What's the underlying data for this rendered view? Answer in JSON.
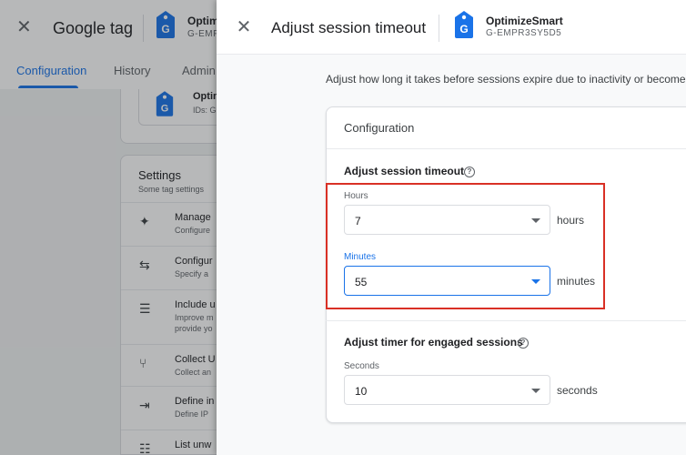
{
  "background": {
    "close_glyph": "✕",
    "title": "Google tag",
    "tag_name": "Optim",
    "tag_id": "G-EMPR",
    "tabs": [
      "Configuration",
      "History",
      "Admin"
    ],
    "card": {
      "name": "Optim",
      "ids": "IDs: G"
    },
    "settings": {
      "title": "Settings",
      "subtitle": "Some tag settings",
      "rows": [
        {
          "icon": "sparkle-icon",
          "glyph": "✦",
          "title": "Manage",
          "sub": "Configure"
        },
        {
          "icon": "merge-arrows-icon",
          "glyph": "⇆",
          "title": "Configur",
          "sub": "Specify a"
        },
        {
          "icon": "consent-list-icon",
          "glyph": "☰",
          "title": "Include u",
          "sub": "Improve m"
        },
        {
          "icon": "fork-icon",
          "glyph": "⑂",
          "title": "Collect U",
          "sub": "Collect an"
        },
        {
          "icon": "login-arrow-icon",
          "glyph": "⇥",
          "title": "Define in",
          "sub": "Define IP"
        },
        {
          "icon": "list-x-icon",
          "glyph": "☷",
          "title": "List unw",
          "sub": ""
        }
      ],
      "extra_line": "provide yo"
    }
  },
  "panel": {
    "close_glyph": "✕",
    "title": "Adjust session timeout",
    "tag_name": "OptimizeSmart",
    "tag_id": "G-EMPR3SY5D5",
    "description": "Adjust how long it takes before sessions expire due to inactivity or become",
    "card": {
      "title": "Configuration",
      "section1": {
        "title": "Adjust session timeout",
        "help_glyph": "?",
        "hours": {
          "label": "Hours",
          "value": "7",
          "unit": "hours"
        },
        "minutes": {
          "label": "Minutes",
          "value": "55",
          "unit": "minutes"
        }
      },
      "section2": {
        "title": "Adjust timer for engaged sessions",
        "help_glyph": "?",
        "seconds": {
          "label": "Seconds",
          "value": "10",
          "unit": "seconds"
        }
      }
    }
  },
  "colors": {
    "accent": "#1a73e8",
    "highlight": "#d93025",
    "tag_blue": "#1a73e8"
  }
}
